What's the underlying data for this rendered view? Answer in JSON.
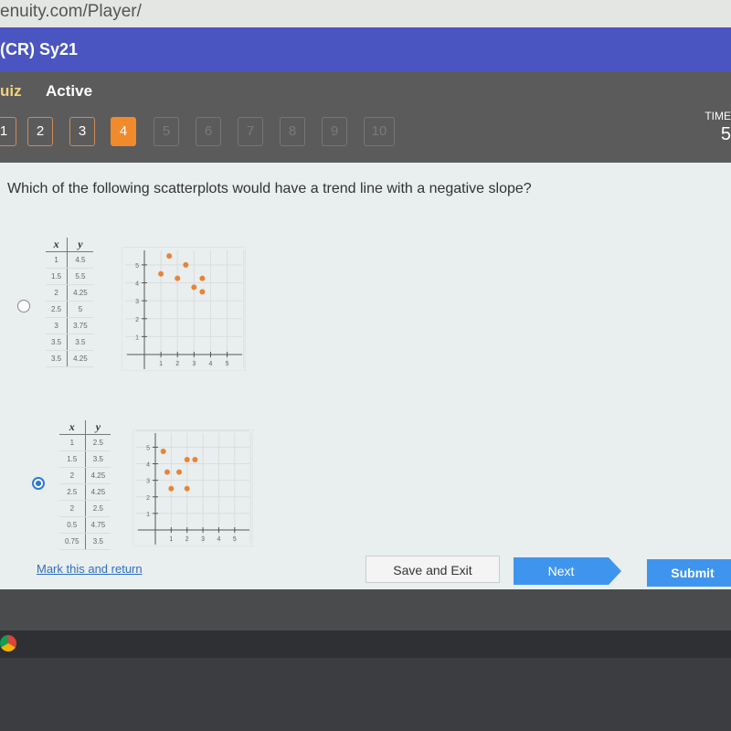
{
  "browser": {
    "url": "enuity.com/Player/"
  },
  "course": {
    "title": "(CR) Sy21"
  },
  "header": {
    "type_label": "uiz",
    "status": "Active",
    "timer_label": "TIME",
    "timer_value": "5"
  },
  "questions": [
    {
      "n": "1",
      "state": "answered"
    },
    {
      "n": "2",
      "state": "answered"
    },
    {
      "n": "3",
      "state": "answered"
    },
    {
      "n": "4",
      "state": "current"
    },
    {
      "n": "5",
      "state": "disabled"
    },
    {
      "n": "6",
      "state": "disabled"
    },
    {
      "n": "7",
      "state": "disabled"
    },
    {
      "n": "8",
      "state": "disabled"
    },
    {
      "n": "9",
      "state": "disabled"
    },
    {
      "n": "10",
      "state": "disabled"
    }
  ],
  "question": {
    "text": "Which of the following scatterplots would have a trend line with a negative slope?"
  },
  "options": [
    {
      "selected": false,
      "headers": [
        "x",
        "y"
      ],
      "rows": [
        [
          "1",
          "4.5"
        ],
        [
          "1.5",
          "5.5"
        ],
        [
          "2",
          "4.25"
        ],
        [
          "2.5",
          "5"
        ],
        [
          "3",
          "3.75"
        ],
        [
          "3.5",
          "3.5"
        ],
        [
          "3.5",
          "4.25"
        ]
      ]
    },
    {
      "selected": true,
      "headers": [
        "x",
        "y"
      ],
      "rows": [
        [
          "1",
          "2.5"
        ],
        [
          "1.5",
          "3.5"
        ],
        [
          "2",
          "4.25"
        ],
        [
          "2.5",
          "4.25"
        ],
        [
          "2",
          "2.5"
        ],
        [
          "0.5",
          "4.75"
        ],
        [
          "0.75",
          "3.5"
        ]
      ]
    }
  ],
  "chart_data": [
    {
      "type": "scatter",
      "x": [
        1,
        1.5,
        2,
        2.5,
        3,
        3.5,
        3.5
      ],
      "y": [
        4.5,
        5.5,
        4.25,
        5,
        3.75,
        3.5,
        4.25
      ],
      "xlim": [
        0,
        5
      ],
      "ylim": [
        0,
        5
      ],
      "xticks": [
        "1",
        "2",
        "3",
        "4",
        "5"
      ],
      "yticks": [
        "1",
        "2",
        "3",
        "4",
        "5"
      ],
      "grid": true,
      "point_color": "#e8843a"
    },
    {
      "type": "scatter",
      "x": [
        1,
        1.5,
        2,
        2.5,
        2,
        0.5,
        0.75
      ],
      "y": [
        2.5,
        3.5,
        4.25,
        4.25,
        2.5,
        4.75,
        3.5
      ],
      "xlim": [
        0,
        5
      ],
      "ylim": [
        0,
        5
      ],
      "xticks": [
        "1",
        "2",
        "3",
        "4",
        "5"
      ],
      "yticks": [
        "1",
        "2",
        "3",
        "4",
        "5"
      ],
      "grid": true,
      "point_color": "#e8843a"
    }
  ],
  "footer": {
    "mark_label": "Mark this and return",
    "save_label": "Save and Exit",
    "next_label": "Next",
    "submit_label": "Submit"
  }
}
